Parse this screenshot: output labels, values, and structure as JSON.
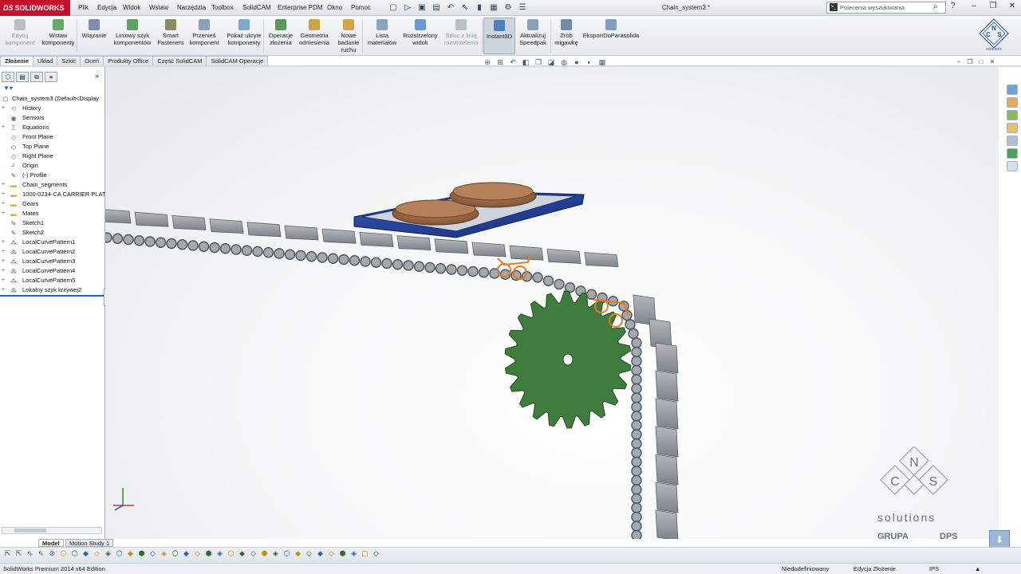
{
  "app": {
    "name": "SOLIDWORKS",
    "doc_title": "Chain_system3 *"
  },
  "menus": [
    "Plik",
    "Edycja",
    "Widok",
    "Wstaw",
    "Narzędzia",
    "Toolbox",
    "SolidCAM",
    "Enterprise PDM",
    "Okno",
    "Pomoc"
  ],
  "search": {
    "placeholder": "Polecenia wyszukiwania"
  },
  "commands": [
    {
      "label": "Edytuj komponent",
      "icon": "edit-component-icon",
      "disabled": true
    },
    {
      "label": "Wstaw komponenty",
      "icon": "insert-components-icon"
    },
    {
      "label": "Wiązanie",
      "icon": "mate-icon"
    },
    {
      "label": "Liniowy szyk komponentów",
      "icon": "linear-pattern-icon"
    },
    {
      "label": "Smart Fasteners",
      "icon": "smart-fasteners-icon"
    },
    {
      "label": "Przenieś komponent",
      "icon": "move-component-icon"
    },
    {
      "label": "Pokaż ukryte komponenty",
      "icon": "show-hidden-icon"
    },
    {
      "label": "Operacje złożenia",
      "icon": "assembly-features-icon"
    },
    {
      "label": "Geometria odniesienia",
      "icon": "reference-geometry-icon"
    },
    {
      "label": "Nowe badanie ruchu",
      "icon": "motion-study-icon"
    },
    {
      "label": "Lista materiałów",
      "icon": "bom-icon"
    },
    {
      "label": "Rozstrzelony widok",
      "icon": "exploded-view-icon"
    },
    {
      "label": "Szkic z linią rozstrzelenia",
      "icon": "explode-line-sketch-icon",
      "disabled": true
    },
    {
      "label": "Instant3D",
      "icon": "instant3d-icon",
      "active": true
    },
    {
      "label": "Aktualizuj Speedpak",
      "icon": "speedpak-icon"
    },
    {
      "label": "Zrób migawkę",
      "icon": "snapshot-icon"
    },
    {
      "label": "EksportDoParasolida",
      "icon": "export-parasolid-icon"
    }
  ],
  "tabs": [
    "Złożenie",
    "Układ",
    "Szkic",
    "Oceń",
    "Produkty Office",
    "Część SolidCAM",
    "SolidCAM Operacje"
  ],
  "tree": {
    "root": "Chain_system3  (Default<Display",
    "items": [
      {
        "label": "History",
        "icon": "history-icon",
        "expand": "+"
      },
      {
        "label": "Sensors",
        "icon": "sensors-icon",
        "expand": ""
      },
      {
        "label": "Equations",
        "icon": "equations-icon",
        "expand": "+"
      },
      {
        "label": "Front Plane",
        "icon": "plane-icon",
        "expand": ""
      },
      {
        "label": "Top Plane",
        "icon": "plane-icon",
        "expand": ""
      },
      {
        "label": "Right Plane",
        "icon": "plane-icon",
        "expand": ""
      },
      {
        "label": "Origin",
        "icon": "origin-icon",
        "expand": ""
      },
      {
        "label": "(-) Profile",
        "icon": "sketch-icon",
        "expand": ""
      },
      {
        "label": "Chain_segments",
        "icon": "folder-icon",
        "expand": "+"
      },
      {
        "label": "1000-0234-CA CARRIER PLAT",
        "icon": "folder-icon",
        "expand": "+"
      },
      {
        "label": "Gears",
        "icon": "folder-icon",
        "expand": "+"
      },
      {
        "label": "Mates",
        "icon": "mates-folder-icon",
        "expand": "+"
      },
      {
        "label": "Sketch1",
        "icon": "sketch-icon",
        "expand": ""
      },
      {
        "label": "Sketch2",
        "icon": "sketch-icon",
        "expand": ""
      },
      {
        "label": "LocalCurvePattern1",
        "icon": "pattern-icon",
        "expand": "+"
      },
      {
        "label": "LocalCurvePattern2",
        "icon": "pattern-icon",
        "expand": "+"
      },
      {
        "label": "LocalCurvePattern3",
        "icon": "pattern-icon",
        "expand": "+"
      },
      {
        "label": "LocalCurvePattern4",
        "icon": "pattern-icon",
        "expand": "+"
      },
      {
        "label": "LocalCurvePattern5",
        "icon": "pattern-icon",
        "expand": "+"
      },
      {
        "label": "Lokalny szyk krzywej2",
        "icon": "pattern-icon",
        "expand": "+"
      }
    ]
  },
  "bottom_tabs": [
    "Model",
    "Motion Study 1"
  ],
  "status": {
    "edition": "SolidWorks Premium 2014 x64 Edition",
    "definition": "Niedodefiniowany",
    "mode": "Edycja Złożenie",
    "units": "IPS"
  },
  "watermark": {
    "letters": [
      "N",
      "C",
      "S"
    ],
    "word": "solutions",
    "group": "GRUPA",
    "brand": "DPS"
  },
  "colors": {
    "accent": "#2a5ec8",
    "gear": "#3f7d3f",
    "chain": "#8e9398",
    "selection": "#e87b1a",
    "plate": "#1f3d8a",
    "disc": "#9b6a45"
  }
}
